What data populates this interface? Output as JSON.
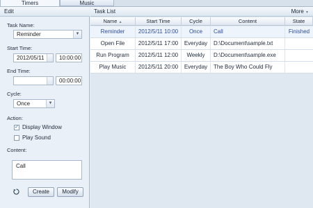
{
  "tabs": [
    {
      "label": "Timers"
    },
    {
      "label": "Music"
    }
  ],
  "edit": {
    "title": "Edit",
    "task_name_label": "Task Name:",
    "task_name_value": "Reminder",
    "start_time_label": "Start Time:",
    "start_date": "2012/05/11",
    "start_clock": "10:00:00",
    "end_time_label": "End Time:",
    "end_date": "  /  /",
    "end_clock": "00:00:00",
    "cycle_label": "Cycle:",
    "cycle_value": "Once",
    "action_label": "Action:",
    "display_window_label": "Display Window",
    "display_window_checked": true,
    "play_sound_label": "Play Sound",
    "play_sound_checked": false,
    "content_label": "Content:",
    "content_value": "Call",
    "create_label": "Create",
    "modify_label": "Modify"
  },
  "task_list": {
    "title": "Task List",
    "more_label": "More",
    "columns": [
      "Name",
      "Start Time",
      "Cycle",
      "Content",
      "State"
    ],
    "rows": [
      {
        "name": "Reminder",
        "start": "2012/5/11 10:00",
        "cycle": "Once",
        "content": "Call",
        "state": "Finished"
      },
      {
        "name": "Open File",
        "start": "2012/5/11 17:00",
        "cycle": "Everyday",
        "content": "D:\\Document\\sample.txt",
        "state": ""
      },
      {
        "name": "Run Program",
        "start": "2012/5/11 12:00",
        "cycle": "Weekly",
        "content": "D:\\Document\\sample.exe",
        "state": ""
      },
      {
        "name": "Play Music",
        "start": "2012/5/11 20:00",
        "cycle": "Everyday",
        "content": "The Boy Who Could Fly",
        "state": ""
      }
    ]
  },
  "colors": {
    "selected_text": "#2b4d9e",
    "panel_bg": "#eaf0f7",
    "border": "#a9b9cc"
  }
}
